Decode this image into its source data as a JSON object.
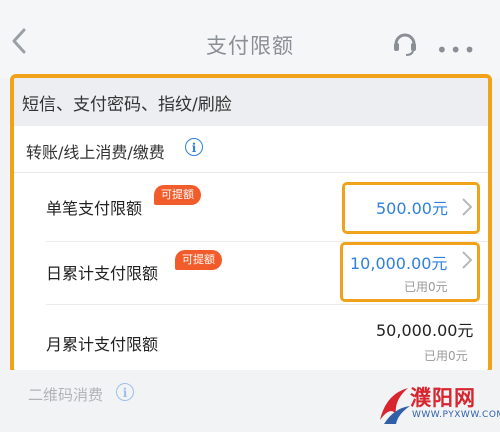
{
  "header": {
    "title": "支付限额"
  },
  "category": {
    "label": "短信、支付密码、指纹/刷脸"
  },
  "section": {
    "label": "转账/线上消费/缴费",
    "info_glyph": "i"
  },
  "rows": [
    {
      "label": "单笔支付限额",
      "badge": "可提额",
      "value": "500.00元"
    },
    {
      "label": "日累计支付限额",
      "badge": "可提额",
      "value": "10,000.00元",
      "used": "已用0元"
    },
    {
      "label": "月累计支付限额",
      "value": "50,000.00元",
      "used": "已用0元"
    }
  ],
  "below": {
    "label": "二维码消费",
    "info_glyph": "i"
  },
  "watermark": {
    "name": "濮阳网",
    "url": "WWW.PYXWW.COM"
  },
  "colors": {
    "accent_blue": "#2f80e0",
    "highlight_orange": "#f0a21a",
    "badge_red": "#f25b2a"
  }
}
